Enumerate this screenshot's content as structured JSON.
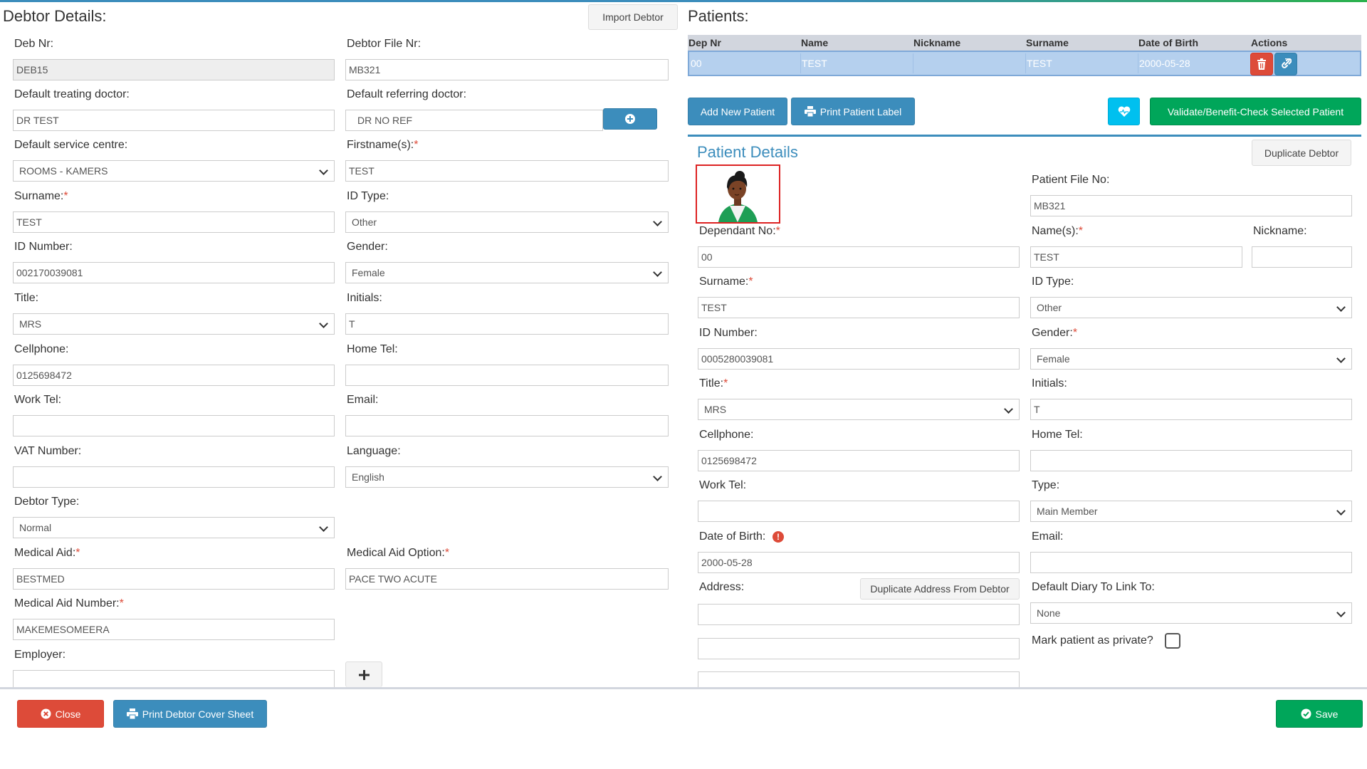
{
  "debtor": {
    "title": "Debtor Details:",
    "import_button": "Import Debtor",
    "deb_nr_label": "Deb Nr:",
    "deb_nr": "DEB15",
    "file_nr_label": "Debtor File Nr:",
    "file_nr": "MB321",
    "treating_label": "Default treating doctor:",
    "treating": "DR TEST",
    "referring_label": "Default referring doctor:",
    "referring": "DR NO REF",
    "service_label": "Default service centre:",
    "service": "ROOMS - KAMERS",
    "firstname_label": "Firstname(s):",
    "firstname": "TEST",
    "surname_label": "Surname:",
    "surname": "TEST",
    "idtype_label": "ID Type:",
    "idtype": "Other",
    "idnumber_label": "ID Number:",
    "idnumber": "002170039081",
    "gender_label": "Gender:",
    "gender": "Female",
    "title_label": "Title:",
    "title_value": "MRS",
    "initials_label": "Initials:",
    "initials": "T",
    "cell_label": "Cellphone:",
    "cell": "0125698472",
    "hometel_label": "Home Tel:",
    "hometel": "",
    "worktel_label": "Work Tel:",
    "worktel": "",
    "email_label": "Email:",
    "email": "",
    "vat_label": "VAT Number:",
    "vat": "",
    "language_label": "Language:",
    "language": "English",
    "debtortype_label": "Debtor Type:",
    "debtortype": "Normal",
    "medaid_label": "Medical Aid:",
    "medaid": "BESTMED",
    "medaidopt_label": "Medical Aid Option:",
    "medaidopt": "PACE TWO ACUTE",
    "medaidnum_label": "Medical Aid Number:",
    "medaidnum": "MAKEMESOMEERA",
    "employer_label": "Employer:",
    "employer": "",
    "req_mark": "*"
  },
  "patients": {
    "title": "Patients:",
    "columns": [
      "Dep Nr",
      "Name",
      "Nickname",
      "Surname",
      "Date of Birth",
      "Actions"
    ],
    "rows": [
      {
        "dep_nr": "00",
        "name": "TEST",
        "nickname": "",
        "surname": "TEST",
        "dob": "2000-05-28"
      }
    ],
    "add_button": "Add New Patient",
    "print_label_button": "Print Patient Label",
    "validate_button": "Validate/Benefit-Check Selected Patient"
  },
  "patient": {
    "title": "Patient Details",
    "duplicate_debtor": "Duplicate Debtor",
    "fileno_label": "Patient File No:",
    "fileno": "MB321",
    "dependant_label": "Dependant No:",
    "dependant": "00",
    "names_label": "Name(s):",
    "names": "TEST",
    "nickname_label": "Nickname:",
    "nickname": "",
    "surname_label": "Surname:",
    "surname": "TEST",
    "idtype_label": "ID Type:",
    "idtype": "Other",
    "idnumber_label": "ID Number:",
    "idnumber": "0005280039081",
    "gender_label": "Gender:",
    "gender": "Female",
    "title_label": "Title:",
    "title_value": "MRS",
    "initials_label": "Initials:",
    "initials": "T",
    "cell_label": "Cellphone:",
    "cell": "0125698472",
    "hometel_label": "Home Tel:",
    "hometel": "",
    "worktel_label": "Work Tel:",
    "worktel": "",
    "type_label": "Type:",
    "type": "Main Member",
    "dob_label": "Date of Birth:",
    "dob": "2000-05-28",
    "email_label": "Email:",
    "email": "",
    "address_label": "Address:",
    "dup_address_button": "Duplicate Address From Debtor",
    "diary_label": "Default Diary To Link To:",
    "diary": "None",
    "private_label": "Mark patient as private?"
  },
  "footer": {
    "close": "Close",
    "print_cover": "Print Debtor Cover Sheet",
    "save": "Save"
  },
  "colors": {
    "primary": "#3c8dbc",
    "success": "#00a65a",
    "danger": "#dd4b39",
    "info": "#00c0ef"
  }
}
